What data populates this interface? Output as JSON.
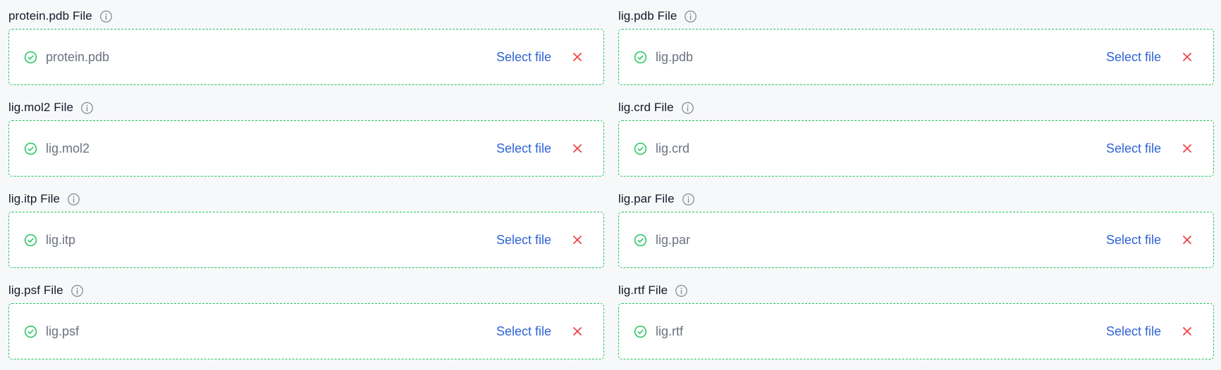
{
  "colors": {
    "success": "#22c55e",
    "link": "#2f63d6",
    "danger": "#ef4444",
    "muted": "#6b7280"
  },
  "select_label": "Select file",
  "fields": [
    {
      "label": "protein.pdb File",
      "filename": "protein.pdb"
    },
    {
      "label": "lig.pdb File",
      "filename": "lig.pdb"
    },
    {
      "label": "lig.mol2 File",
      "filename": "lig.mol2"
    },
    {
      "label": "lig.crd File",
      "filename": "lig.crd"
    },
    {
      "label": "lig.itp File",
      "filename": "lig.itp"
    },
    {
      "label": "lig.par File",
      "filename": "lig.par"
    },
    {
      "label": "lig.psf File",
      "filename": "lig.psf"
    },
    {
      "label": "lig.rtf File",
      "filename": "lig.rtf"
    }
  ]
}
